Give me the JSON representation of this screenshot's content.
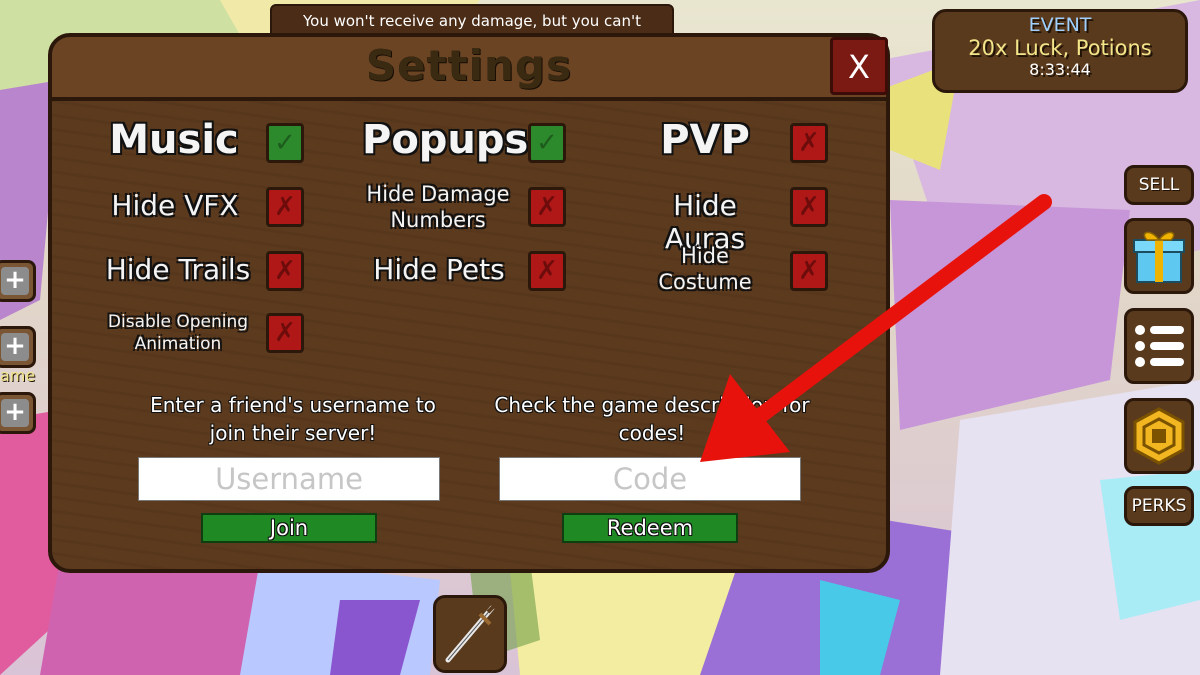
{
  "notice": {
    "text": "You won't receive any damage, but you can't"
  },
  "event": {
    "title": "EVENT",
    "line": "20x Luck, Potions",
    "timer": "8:33:44"
  },
  "side_buttons": {
    "sell": "SELL",
    "perks": "PERKS"
  },
  "left_label": "ame",
  "settings": {
    "title": "Settings",
    "close": "X",
    "toggles": {
      "music": {
        "label": "Music",
        "state": "on",
        "mark": "✓"
      },
      "popups": {
        "label": "Popups",
        "state": "on",
        "mark": "✓"
      },
      "pvp": {
        "label": "PVP",
        "state": "off",
        "mark": "✗"
      },
      "hide_vfx": {
        "label": "Hide VFX",
        "state": "off",
        "mark": "✗"
      },
      "hide_damage": {
        "label_l1": "Hide Damage",
        "label_l2": "Numbers",
        "state": "off",
        "mark": "✗"
      },
      "hide_auras": {
        "label": "Hide Auras",
        "state": "off",
        "mark": "✗"
      },
      "hide_trails": {
        "label": "Hide Trails",
        "state": "off",
        "mark": "✗"
      },
      "hide_pets": {
        "label": "Hide Pets",
        "state": "off",
        "mark": "✗"
      },
      "hide_costume": {
        "label_l1": "Hide",
        "label_l2": "Costume",
        "state": "off",
        "mark": "✗"
      },
      "disable_opening": {
        "label_l1": "Disable Opening",
        "label_l2": "Animation",
        "state": "off",
        "mark": "✗"
      }
    },
    "join": {
      "hint_l1": "Enter a friend's username to",
      "hint_l2": "join their server!",
      "placeholder": "Username",
      "button": "Join"
    },
    "redeem": {
      "hint_l1": "Check the game description for",
      "hint_l2": "codes!",
      "placeholder": "Code",
      "button": "Redeem"
    }
  },
  "colors": {
    "wood": "#5c3a1e",
    "check_on": "#2c8a2c",
    "check_off": "#b01818",
    "arrow": "#e8120c"
  }
}
